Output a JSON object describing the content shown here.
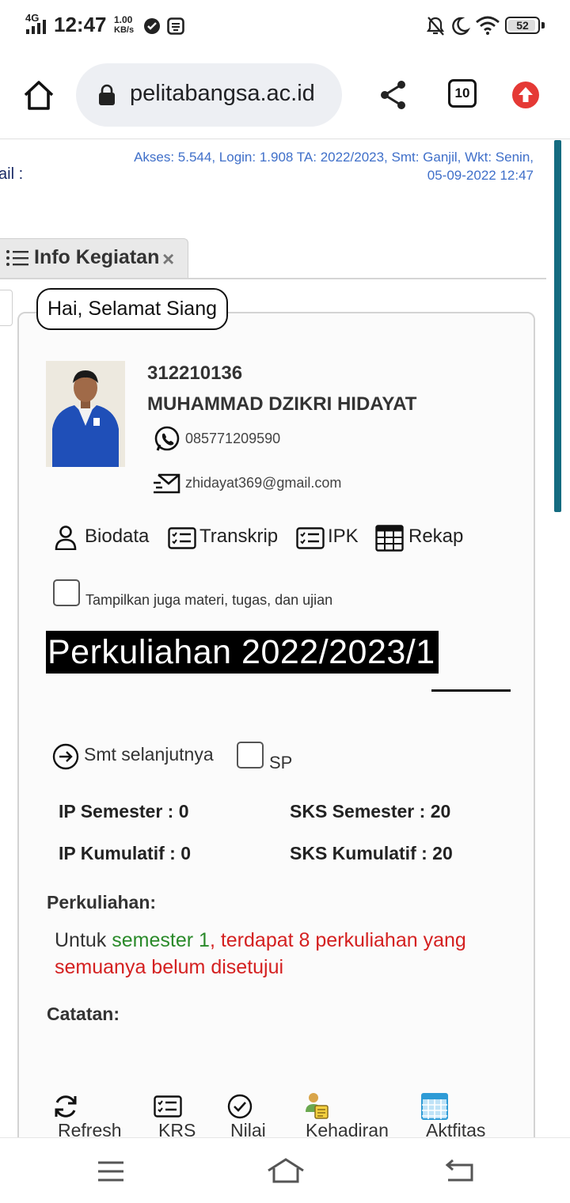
{
  "status_bar": {
    "network": "4G",
    "time": "12:47",
    "speed_value": "1.00",
    "speed_unit": "KB/s",
    "battery": "52"
  },
  "browser": {
    "url": "pelitabangsa.ac.id",
    "tab_count": "10"
  },
  "page": {
    "access_line1": "Akses: 5.544, Login: 1.908 TA: 2022/2023, Smt: Ganjil, Wkt: Senin,",
    "access_line2": "05-09-2022 12:47",
    "mail_fragment": "ail :",
    "tab_label": "Info Kegiatan",
    "tab_close": "×",
    "greeting": "Hai, Selamat Siang",
    "student": {
      "nim": "312210136",
      "name": "MUHAMMAD DZIKRI HIDAYAT",
      "phone": "085771209590",
      "email": "zhidayat369@gmail.com"
    },
    "menu": {
      "biodata": "Biodata",
      "transkrip": "Transkrip",
      "ipk": "IPK",
      "rekap": "Rekap"
    },
    "show_materials_label": "Tampilkan juga materi, tugas, dan ujian",
    "period_title": "Perkuliahan 2022/2023/1",
    "next_semester_label": "Smt selanjutnya",
    "sp_label": "SP",
    "stats": {
      "ip_semester": "IP Semester : 0",
      "sks_semester": "SKS Semester : 20",
      "ip_kumulatif": "IP Kumulatif : 0",
      "sks_kumulatif": "SKS Kumulatif : 20"
    },
    "perkuliahan_heading": "Perkuliahan:",
    "perkuliahan_msg": {
      "prefix": "Untuk ",
      "semester": "semester 1",
      "comma": ",",
      "detail_1": " terdapat 8 perkuliahan yang",
      "detail_2": "semuanya belum disetujui"
    },
    "catatan_heading": "Catatan:",
    "actions": {
      "refresh": "Refresh",
      "krs": "KRS",
      "nilai": "Nilai",
      "kehadiran": "Kehadiran",
      "aktifitas": "Aktfitas"
    }
  },
  "colors": {
    "link_blue": "#3f6fc9",
    "green": "#2a8a2a",
    "red": "#d42020",
    "scrollbar": "#146b80",
    "upload_red": "#e53935"
  }
}
